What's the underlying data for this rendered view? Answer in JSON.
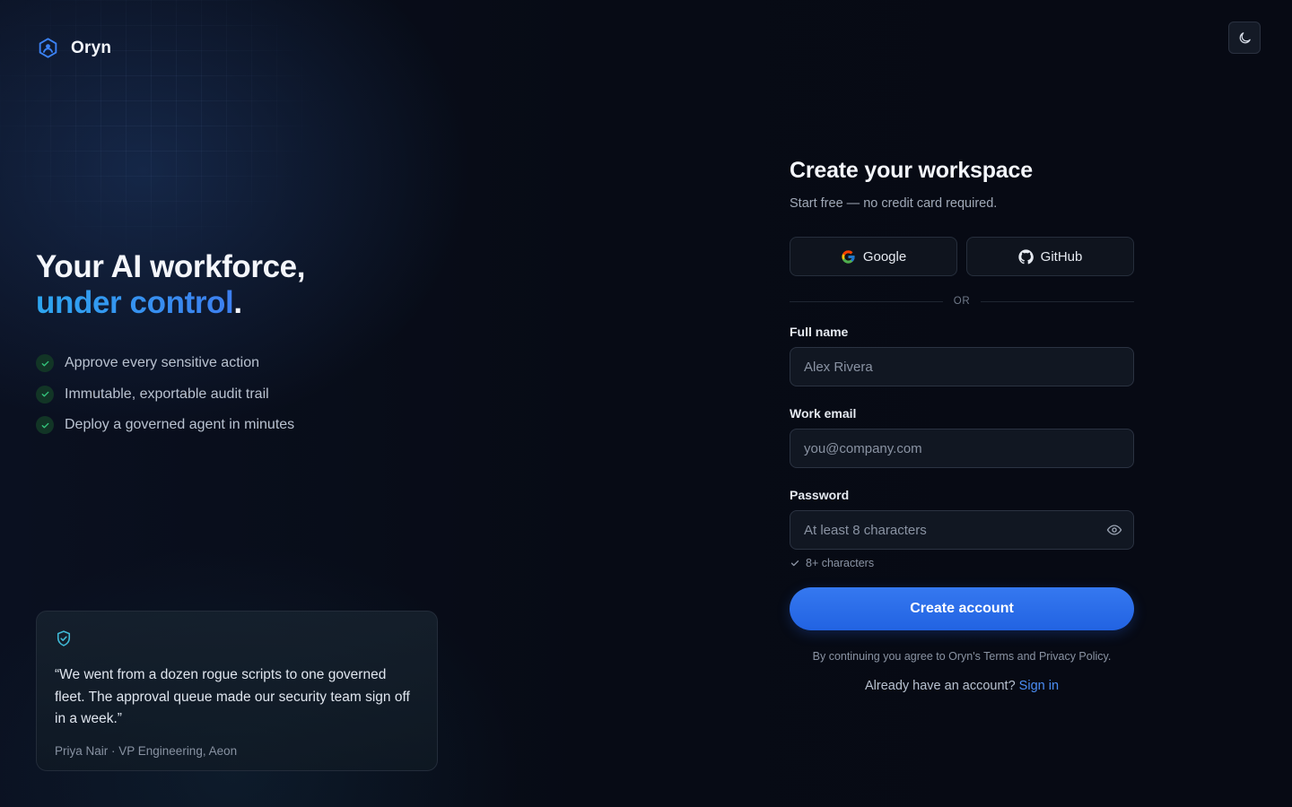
{
  "brand": {
    "name": "Oryn",
    "accent_color": "#3b82f6"
  },
  "hero": {
    "title_line1": "Your AI workforce,",
    "title_accent": "under control",
    "title_punct": ".",
    "features": [
      {
        "icon": "check-icon",
        "text": "Approve every sensitive action"
      },
      {
        "icon": "check-icon",
        "text": "Immutable, exportable audit trail"
      },
      {
        "icon": "check-icon",
        "text": "Deploy a governed agent in minutes"
      }
    ]
  },
  "testimonial": {
    "icon": "shield-check-icon",
    "quote": "“We went from a dozen rogue scripts to one governed fleet. The approval queue made our security team sign off in a week.”",
    "author": "Priya Nair · VP Engineering, Aeon"
  },
  "theme_toggle": {
    "icon": "moon-icon"
  },
  "form": {
    "title": "Create your workspace",
    "subtitle": "Start free — no credit card required.",
    "social": {
      "google_label": "Google",
      "github_label": "GitHub"
    },
    "divider": "OR",
    "full_name": {
      "label": "Full name",
      "placeholder": "Alex Rivera",
      "value": ""
    },
    "email": {
      "label": "Work email",
      "placeholder": "you@company.com",
      "value": ""
    },
    "password": {
      "label": "Password",
      "placeholder": "At least 8 characters",
      "value": "",
      "hint": "8+ characters"
    },
    "submit_label": "Create account",
    "legal": "By continuing you agree to Oryn's Terms and Privacy Policy.",
    "signin_prompt": "Already have an account?",
    "signin_link": "Sign in"
  }
}
